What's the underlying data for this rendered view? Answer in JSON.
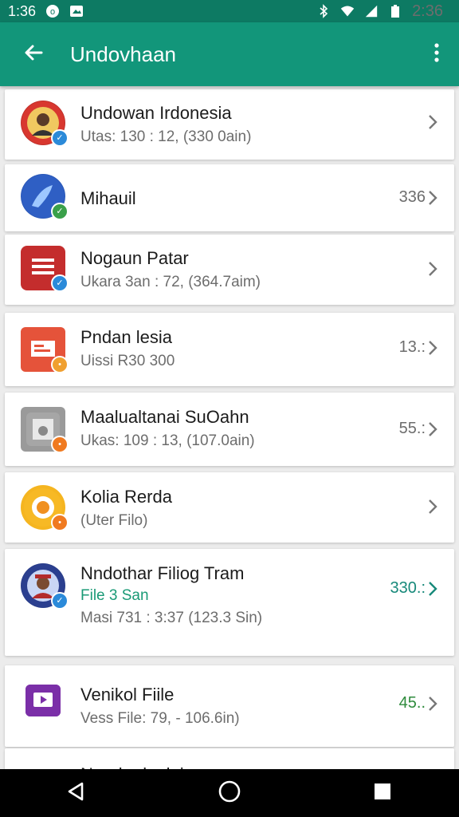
{
  "status_bar": {
    "time_left": "1:36",
    "time_right": "2:36",
    "icons": [
      "notification-icon",
      "photo-icon",
      "bluetooth-icon",
      "wifi-icon",
      "signal-icon",
      "battery-icon"
    ]
  },
  "app_bar": {
    "title": "Undovhaan",
    "back_icon": "arrow-back-icon",
    "menu_icon": "more-vert-icon"
  },
  "items": [
    {
      "name": "Undowan Irdonesia",
      "sub1": "Utas: 130 : 12,  (330 0ain)",
      "right": ""
    },
    {
      "name": "Mihauil",
      "sub1": "",
      "right": "336"
    },
    {
      "name": "Nogaun Patar",
      "sub1": "Ukara 3an : 72,  (364.7aim)",
      "right": ""
    },
    {
      "name": "Pndan lesia",
      "sub1": "Uissi R30 300",
      "right": "13.:"
    },
    {
      "name": "Maalualtanai SuOahn",
      "sub1": "Ukas: 109 : 13,  (107.0ain)",
      "right": "55.:"
    },
    {
      "name": "Kolia Rerda",
      "sub1": "(Uter Filo)",
      "right": ""
    },
    {
      "name": "Nndothar Filiog Tram",
      "sub1": "File 3 San",
      "sub2": "Masi 731 : 3:37  (123.3 Sin)",
      "right": "330.:"
    },
    {
      "name": "Venikol Fiile",
      "sub1": "Vess File: 79,  - 106.6in)",
      "right": "45.."
    },
    {
      "name": "Nandar lanlaia",
      "sub1": "",
      "right": ""
    }
  ],
  "nav_bar": {
    "icons": [
      "back-triangle-icon",
      "home-circle-icon",
      "recents-square-icon"
    ]
  },
  "colors": {
    "status_bar": "#0d7a63",
    "app_bar": "#12967a",
    "accent_teal": "#17897a",
    "accent_green": "#2e8b3c"
  }
}
